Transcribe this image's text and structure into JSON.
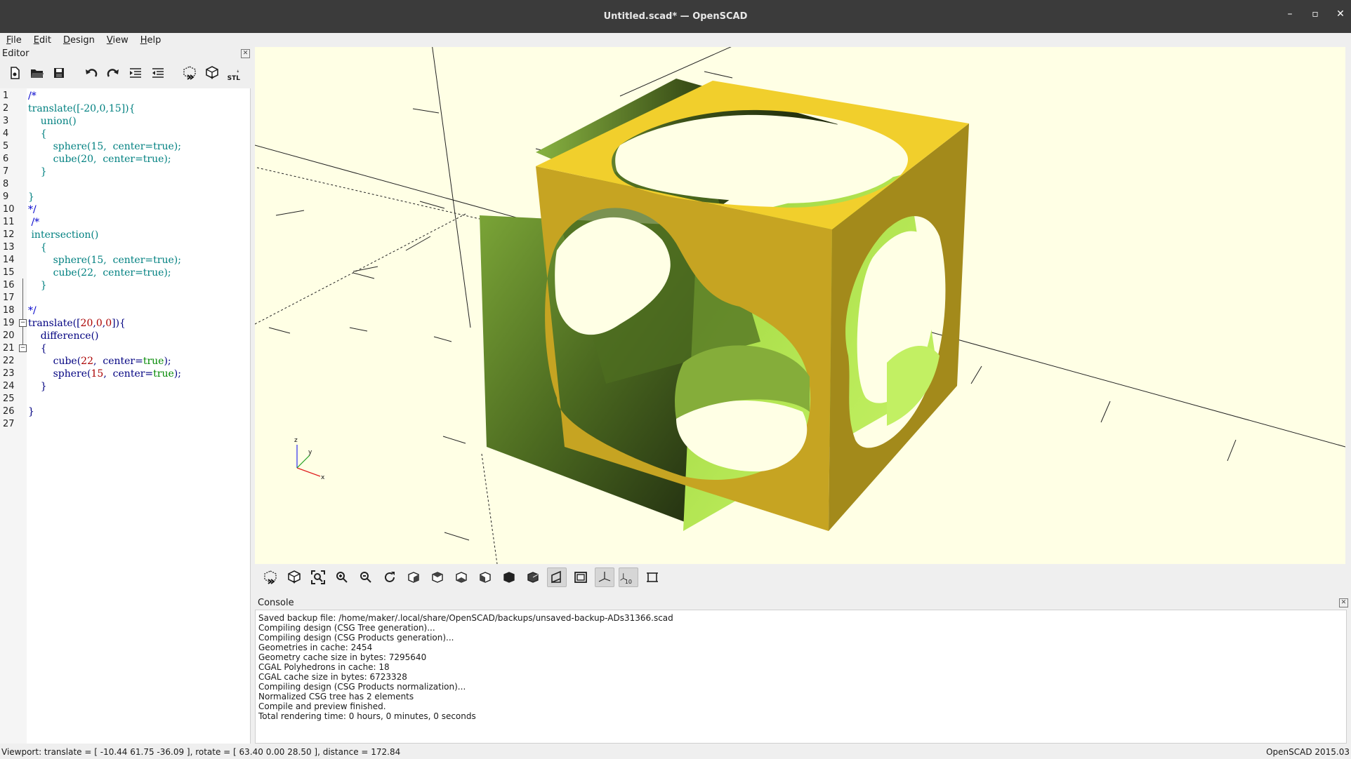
{
  "window": {
    "title": "Untitled.scad* — OpenSCAD",
    "controls": [
      "–",
      "▫",
      "✕"
    ]
  },
  "menubar": {
    "items": [
      {
        "label": "File",
        "underline": "F",
        "rest": "ile"
      },
      {
        "label": "Edit",
        "underline": "E",
        "rest": "dit"
      },
      {
        "label": "Design",
        "underline": "D",
        "rest": "esign"
      },
      {
        "label": "View",
        "underline": "V",
        "rest": "iew"
      },
      {
        "label": "Help",
        "underline": "H",
        "rest": "elp"
      }
    ]
  },
  "editor": {
    "panel_title": "Editor",
    "toolbar_icons": [
      "new-file-icon",
      "open-file-icon",
      "save-icon",
      "undo-icon",
      "redo-icon",
      "indent-icon",
      "unindent-icon",
      "preview-icon",
      "render-icon",
      "export-stl-icon"
    ],
    "stl_label": "STL",
    "lines": [
      {
        "n": "1",
        "parts": [
          {
            "t": "/*",
            "c": "c-comment"
          }
        ]
      },
      {
        "n": "2",
        "parts": [
          {
            "t": "translate([-20,0,15]){",
            "c": "c-teal"
          }
        ]
      },
      {
        "n": "3",
        "parts": [
          {
            "t": "    union()",
            "c": "c-teal"
          }
        ]
      },
      {
        "n": "4",
        "parts": [
          {
            "t": "    {",
            "c": "c-teal"
          }
        ]
      },
      {
        "n": "5",
        "parts": [
          {
            "t": "        sphere(15,  center=true);",
            "c": "c-teal"
          }
        ]
      },
      {
        "n": "6",
        "parts": [
          {
            "t": "        cube(20,  center=true);",
            "c": "c-teal"
          }
        ]
      },
      {
        "n": "7",
        "parts": [
          {
            "t": "    }",
            "c": "c-teal"
          }
        ]
      },
      {
        "n": "8",
        "parts": []
      },
      {
        "n": "9",
        "parts": [
          {
            "t": "}",
            "c": "c-teal"
          }
        ]
      },
      {
        "n": "10",
        "parts": [
          {
            "t": "*/",
            "c": "c-comment"
          }
        ]
      },
      {
        "n": "11",
        "parts": [
          {
            "t": " /*",
            "c": "c-comment"
          }
        ]
      },
      {
        "n": "12",
        "parts": [
          {
            "t": " intersection()",
            "c": "c-teal"
          }
        ]
      },
      {
        "n": "13",
        "parts": [
          {
            "t": "    {",
            "c": "c-teal"
          }
        ]
      },
      {
        "n": "14",
        "parts": [
          {
            "t": "        sphere(15,  center=true);",
            "c": "c-teal"
          }
        ]
      },
      {
        "n": "15",
        "parts": [
          {
            "t": "        cube(22,  center=true);",
            "c": "c-teal"
          }
        ]
      },
      {
        "n": "16",
        "parts": [
          {
            "t": "    }",
            "c": "c-teal"
          }
        ]
      },
      {
        "n": "17",
        "parts": []
      },
      {
        "n": "18",
        "parts": [
          {
            "t": "*/",
            "c": "c-comment"
          }
        ]
      },
      {
        "n": "19",
        "fold": true,
        "parts": [
          {
            "t": "translate([",
            "c": "c-navy"
          },
          {
            "t": "20",
            "c": "c-red"
          },
          {
            "t": ",",
            "c": "c-navy"
          },
          {
            "t": "0",
            "c": "c-red"
          },
          {
            "t": ",",
            "c": "c-navy"
          },
          {
            "t": "0",
            "c": "c-red"
          },
          {
            "t": "]){",
            "c": "c-navy"
          }
        ]
      },
      {
        "n": "20",
        "parts": [
          {
            "t": "    difference()",
            "c": "c-navy"
          }
        ]
      },
      {
        "n": "21",
        "fold": true,
        "parts": [
          {
            "t": "    {",
            "c": "c-navy"
          }
        ]
      },
      {
        "n": "22",
        "parts": [
          {
            "t": "        cube(",
            "c": "c-navy"
          },
          {
            "t": "22",
            "c": "c-red"
          },
          {
            "t": ",  center=",
            "c": "c-navy"
          },
          {
            "t": "true",
            "c": "c-green"
          },
          {
            "t": ");",
            "c": "c-navy"
          }
        ]
      },
      {
        "n": "23",
        "parts": [
          {
            "t": "        sphere(",
            "c": "c-navy"
          },
          {
            "t": "15",
            "c": "c-red"
          },
          {
            "t": ",  center=",
            "c": "c-navy"
          },
          {
            "t": "true",
            "c": "c-green"
          },
          {
            "t": ");",
            "c": "c-navy"
          }
        ]
      },
      {
        "n": "24",
        "parts": [
          {
            "t": "    }",
            "c": "c-navy"
          }
        ]
      },
      {
        "n": "25",
        "parts": []
      },
      {
        "n": "26",
        "parts": [
          {
            "t": "}",
            "c": "c-navy"
          }
        ]
      },
      {
        "n": "27",
        "parts": []
      }
    ]
  },
  "viewport": {
    "axis_labels": {
      "z": "z",
      "y": "y",
      "x": "x"
    },
    "colors": {
      "background": "#ffffe5",
      "face_top": "#f1cf2c",
      "face_front": "#c6a422",
      "face_right": "#a38a1b",
      "hole_dark": "#2f3d16",
      "hole_mid": "#6b8a2c",
      "hole_light": "#b5e34f"
    }
  },
  "view_toolbar": {
    "icons": [
      "preview-icon",
      "render-icon",
      "view-all-icon",
      "zoom-in-icon",
      "zoom-out-icon",
      "reset-view-icon",
      "view-right-icon",
      "view-top-icon",
      "view-bottom-icon",
      "view-left-icon",
      "view-front-icon",
      "view-back-icon",
      "perspective-icon",
      "orthogonal-icon",
      "show-axes-icon",
      "show-scale-markers-icon",
      "show-edges-icon"
    ],
    "active": [
      "perspective-icon",
      "show-axes-icon",
      "show-scale-markers-icon"
    ],
    "scale_label": "10"
  },
  "console": {
    "title": "Console",
    "lines": [
      "Saved backup file: /home/maker/.local/share/OpenSCAD/backups/unsaved-backup-ADs31366.scad",
      "Compiling design (CSG Tree generation)...",
      "Compiling design (CSG Products generation)...",
      "Geometries in cache: 2454",
      "Geometry cache size in bytes: 7295640",
      "CGAL Polyhedrons in cache: 18",
      "CGAL cache size in bytes: 6723328",
      "Compiling design (CSG Products normalization)...",
      "Normalized CSG tree has 2 elements",
      "Compile and preview finished.",
      "Total rendering time: 0 hours, 0 minutes, 0 seconds"
    ]
  },
  "statusbar": {
    "viewport_info": "Viewport: translate = [ -10.44 61.75 -36.09 ], rotate = [ 63.40 0.00 28.50 ], distance = 172.84",
    "version": "OpenSCAD 2015.03"
  }
}
